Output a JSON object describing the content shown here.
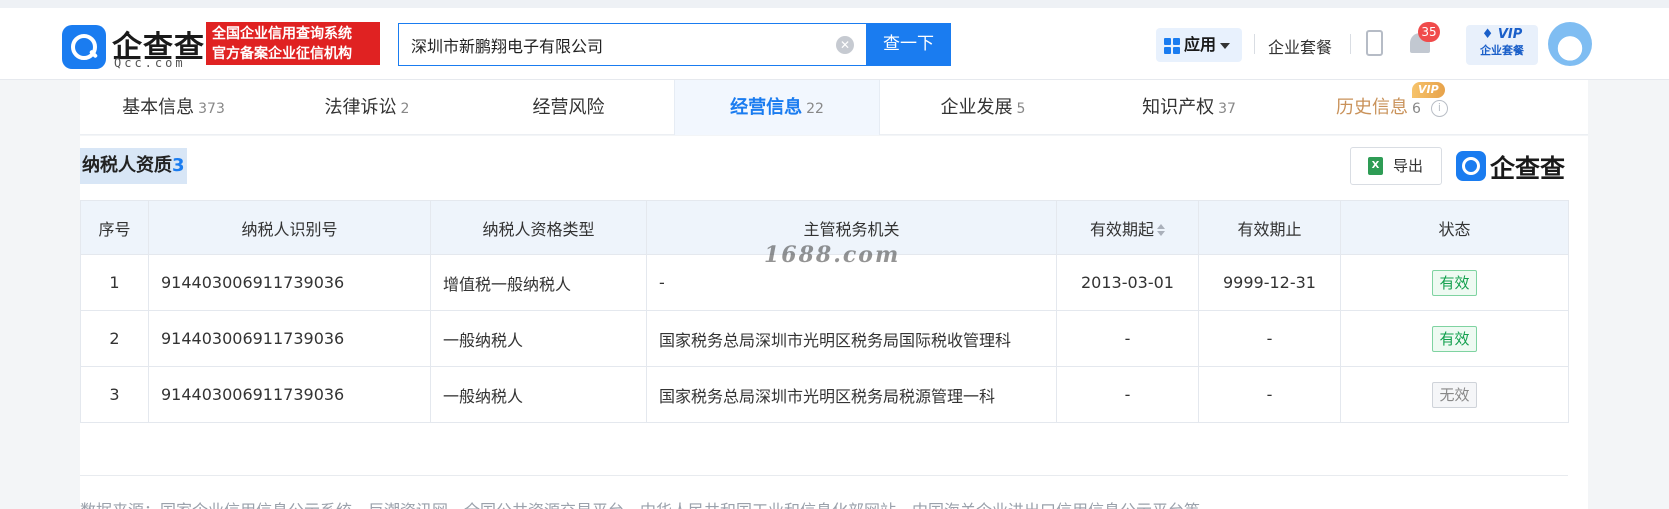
{
  "header": {
    "logo_text": "企查查",
    "logo_sub": "Qcc.com",
    "badge_line1": "全国企业信用查询系统",
    "badge_line2": "官方备案企业征信机构",
    "search_value": "深圳市新鹏翔电子有限公司",
    "search_button": "查一下",
    "apps_label": "应用",
    "package_label": "企业套餐",
    "notification_count": "35",
    "vip_line1": "VIP",
    "vip_line2": "企业套餐"
  },
  "tabs": [
    {
      "label": "基本信息",
      "count": "373"
    },
    {
      "label": "法律诉讼",
      "count": "2"
    },
    {
      "label": "经营风险",
      "count": ""
    },
    {
      "label": "经营信息",
      "count": "22"
    },
    {
      "label": "企业发展",
      "count": "5"
    },
    {
      "label": "知识产权",
      "count": "37"
    },
    {
      "label": "历史信息",
      "count": "6"
    }
  ],
  "history_vip_tag": "VIP",
  "section": {
    "title": "纳税人资质",
    "count": "3",
    "export_label": "导出",
    "brand": "企查查"
  },
  "table": {
    "headers": [
      "序号",
      "纳税人识别号",
      "纳税人资格类型",
      "主管税务机关",
      "有效期起",
      "有效期止",
      "状态"
    ],
    "rows": [
      [
        "1",
        "914403006911739036",
        "增值税一般纳税人",
        "-",
        "2013-03-01",
        "9999-12-31",
        "有效"
      ],
      [
        "2",
        "914403006911739036",
        "一般纳税人",
        "国家税务总局深圳市光明区税务局国际税收管理科",
        "-",
        "-",
        "有效"
      ],
      [
        "3",
        "914403006911739036",
        "一般纳税人",
        "国家税务总局深圳市光明区税务局税源管理一科",
        "-",
        "-",
        "无效"
      ]
    ]
  },
  "watermark": "1688.com",
  "footer_source": "数据来源：国家企业信用信息公示系统、巨潮资讯网、全国公共资源交易平台、中华人民共和国工业和信息化部网站、中国海关企业进出口信用信息公示平台等",
  "colors": {
    "accent": "#1a7cf0",
    "badge_red": "#e02222",
    "valid_green": "#13a04e"
  }
}
